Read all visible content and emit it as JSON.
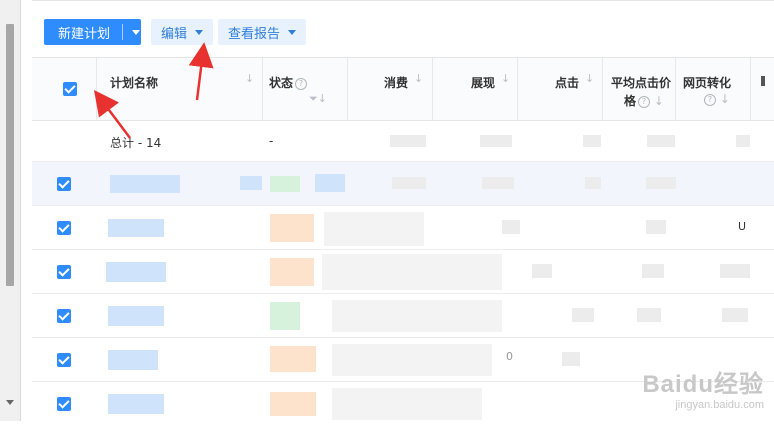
{
  "toolbar": {
    "new_plan_label": "新建计划",
    "edit_label": "编辑",
    "report_label": "查看报告"
  },
  "table": {
    "headers": {
      "plan_name": "计划名称",
      "status": "状态",
      "spend": "消费",
      "impressions": "展现",
      "clicks": "点击",
      "avg_cpc_line1": "平均点击价",
      "avg_cpc_line2": "格",
      "web_conv": "网页转化"
    },
    "total_label": "总计 - 14",
    "total_status": "-",
    "row_fragments": [
      "U",
      "0"
    ]
  },
  "colors": {
    "primary": "#2f8cff",
    "checkbox": "#2f8cff",
    "annotation_arrow": "#e8322f"
  },
  "watermark": {
    "brand": "Baidu经验",
    "url": "jingyan.baidu.com"
  }
}
